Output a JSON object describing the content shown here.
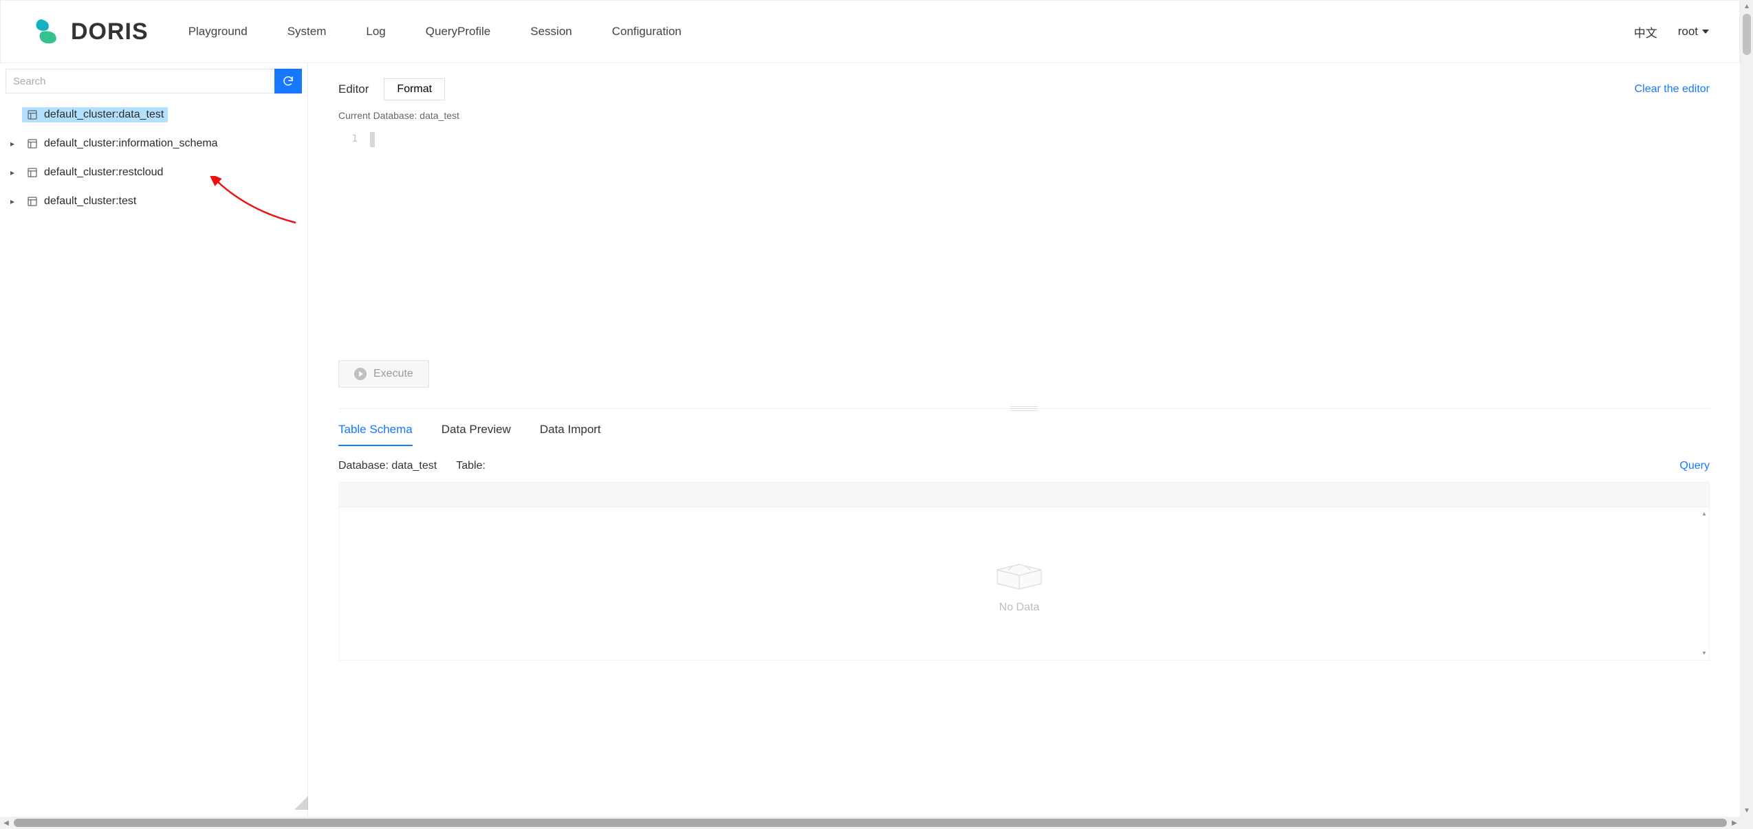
{
  "header": {
    "brand": "DORIS",
    "nav": {
      "playground": "Playground",
      "system": "System",
      "log": "Log",
      "query_profile": "QueryProfile",
      "session": "Session",
      "configuration": "Configuration"
    },
    "lang": "中文",
    "user": "root"
  },
  "sidebar": {
    "search_placeholder": "Search",
    "items": [
      {
        "label": "default_cluster:data_test",
        "selected": true,
        "expandable": false
      },
      {
        "label": "default_cluster:information_schema",
        "selected": false,
        "expandable": true
      },
      {
        "label": "default_cluster:restcloud",
        "selected": false,
        "expandable": true
      },
      {
        "label": "default_cluster:test",
        "selected": false,
        "expandable": true
      }
    ]
  },
  "editor": {
    "title": "Editor",
    "format_label": "Format",
    "clear_label": "Clear the editor",
    "current_db_label": "Current Database: data_test",
    "line_number": "1",
    "execute_label": "Execute"
  },
  "tabs": {
    "schema": "Table Schema",
    "preview": "Data Preview",
    "import": "Data Import"
  },
  "schema_panel": {
    "database_label": "Database: data_test",
    "table_label": "Table:",
    "query_label": "Query",
    "empty_label": "No Data"
  }
}
